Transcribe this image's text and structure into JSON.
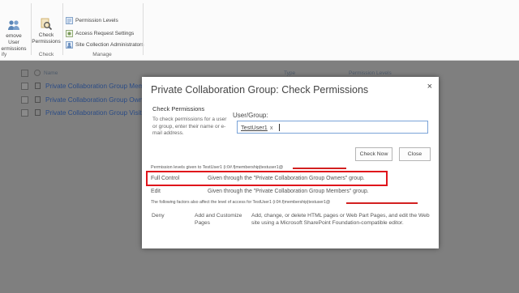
{
  "ribbon": {
    "remove_user": [
      "emove User",
      "ermissions"
    ],
    "remove_group_label": "ify",
    "check": [
      "Check",
      "Permissions"
    ],
    "check_group_label": "Check",
    "manage_items": [
      "Permission Levels",
      "Access Request Settings",
      "Site Collection Administrators"
    ],
    "manage_group_label": "Manage"
  },
  "list": {
    "col_name": "Name",
    "col_type": "Type",
    "col_perm": "Permission Levels",
    "rows": [
      "Private Collaboration Group Membe",
      "Private Collaboration Group Owners",
      "Private Collaboration Group Visitors"
    ]
  },
  "dialog": {
    "title": "Private Collaboration Group: Check Permissions",
    "close": "×",
    "section_heading": "Check Permissions",
    "section_desc": "To check permissions for a user or group, enter their name or e-mail address.",
    "user_group_label": "User/Group:",
    "user_token": "TestUser1",
    "token_remove": "x",
    "check_now": "Check Now",
    "close_button": "Close",
    "given_text": "Permission levels given to TestUser1 (i:0#.f|membership|testuser1@",
    "permissions": [
      {
        "level": "Full Control",
        "via": "Given through the \"Private Collaboration Group Owners\" group."
      },
      {
        "level": "Edit",
        "via": "Given through the \"Private Collaboration Group Members\" group."
      }
    ],
    "factors_text": "The following factors also affect the level of access for TestUser1 (i:0#.f|membership|testuser1@",
    "factor": {
      "name": "Deny",
      "permission": "Add and Customize Pages",
      "description": "Add, change, or delete HTML pages or Web Part Pages, and edit the Web site using a Microsoft SharePoint Foundation-compatible editor."
    }
  },
  "colors": {
    "highlight": "#e0141b",
    "link": "#2b4c86",
    "input_border": "#7aa3d8"
  }
}
